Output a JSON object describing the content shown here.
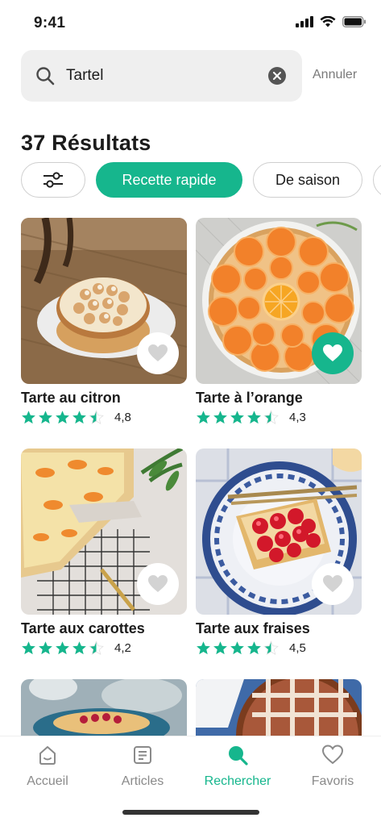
{
  "status_bar": {
    "time": "9:41"
  },
  "search": {
    "query": "Tartel",
    "cancel_label": "Annuler"
  },
  "results_title": "37 Résultats",
  "filters": {
    "chips": [
      {
        "label": "Recette rapide",
        "active": true
      },
      {
        "label": "De saison",
        "active": false
      }
    ]
  },
  "recipes": [
    {
      "title": "Tarte au citron",
      "rating": "4,8",
      "stars": 4.5,
      "favorite": false,
      "icon": "heart-icon"
    },
    {
      "title": "Tarte à l’orange",
      "rating": "4,3",
      "stars": 4.5,
      "favorite": true,
      "icon": "heart-icon"
    },
    {
      "title": "Tarte aux carottes",
      "rating": "4,2",
      "stars": 4.5,
      "favorite": false,
      "icon": "heart-icon"
    },
    {
      "title": "Tarte aux fraises",
      "rating": "4,5",
      "stars": 4.5,
      "favorite": false,
      "icon": "heart-icon"
    }
  ],
  "tabbar": {
    "items": [
      {
        "label": "Accueil",
        "icon": "home-icon"
      },
      {
        "label": "Articles",
        "icon": "articles-icon"
      },
      {
        "label": "Rechercher",
        "icon": "search-icon",
        "active": true
      },
      {
        "label": "Favoris",
        "icon": "heart-icon"
      }
    ]
  },
  "colors": {
    "accent": "#16b68d",
    "text": "#1c1c1c",
    "muted": "#8a8a8a"
  }
}
